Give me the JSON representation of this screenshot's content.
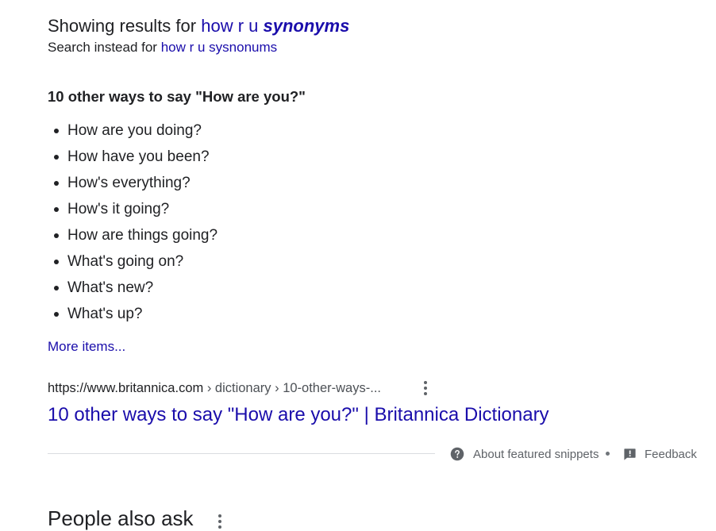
{
  "spelling": {
    "showing_prefix": "Showing results for",
    "corrected_query_plain": "how r u",
    "corrected_query_emphasis": "synonyms",
    "instead_prefix": "Search instead for",
    "original_query": "how r u sysnonums"
  },
  "featured_snippet": {
    "heading": "10 other ways to say \"How are you?\"",
    "items": [
      "How are you doing?",
      "How have you been?",
      "How's everything?",
      "How's it going?",
      "How are things going?",
      "What's going on?",
      "What's new?",
      "What's up?"
    ],
    "more_items_label": "More items...",
    "source": {
      "domain": "https://www.britannica.com",
      "path": " › dictionary › 10-other-ways-...",
      "title": "10 other ways to say \"How are you?\" | Britannica Dictionary"
    },
    "footer": {
      "about_label": "About featured snippets",
      "feedback_label": "Feedback"
    }
  },
  "people_also_ask": {
    "title": "People also ask"
  },
  "colors": {
    "link": "#1a0dab",
    "text": "#202124",
    "secondary_text": "#5f6368",
    "divider": "#dadce0"
  },
  "icons": {
    "menu": "more-vert-icon",
    "help": "help-circle-icon",
    "feedback": "feedback-icon"
  }
}
